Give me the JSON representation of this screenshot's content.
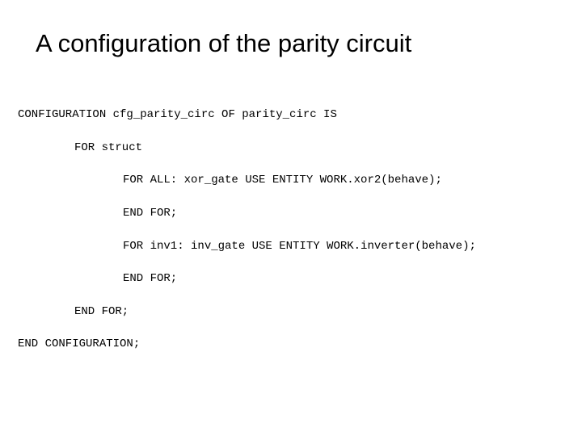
{
  "title": "A configuration of the parity  circuit",
  "code": {
    "l1": "CONFIGURATION cfg_parity_circ OF parity_circ IS",
    "l2": "FOR struct",
    "l3": "FOR ALL: xor_gate USE ENTITY WORK.xor2(behave);",
    "l4": "END FOR;",
    "l5": "FOR inv1: inv_gate USE ENTITY WORK.inverter(behave);",
    "l6": "END FOR;",
    "l7": "END FOR;",
    "l8": "END CONFIGURATION;"
  }
}
